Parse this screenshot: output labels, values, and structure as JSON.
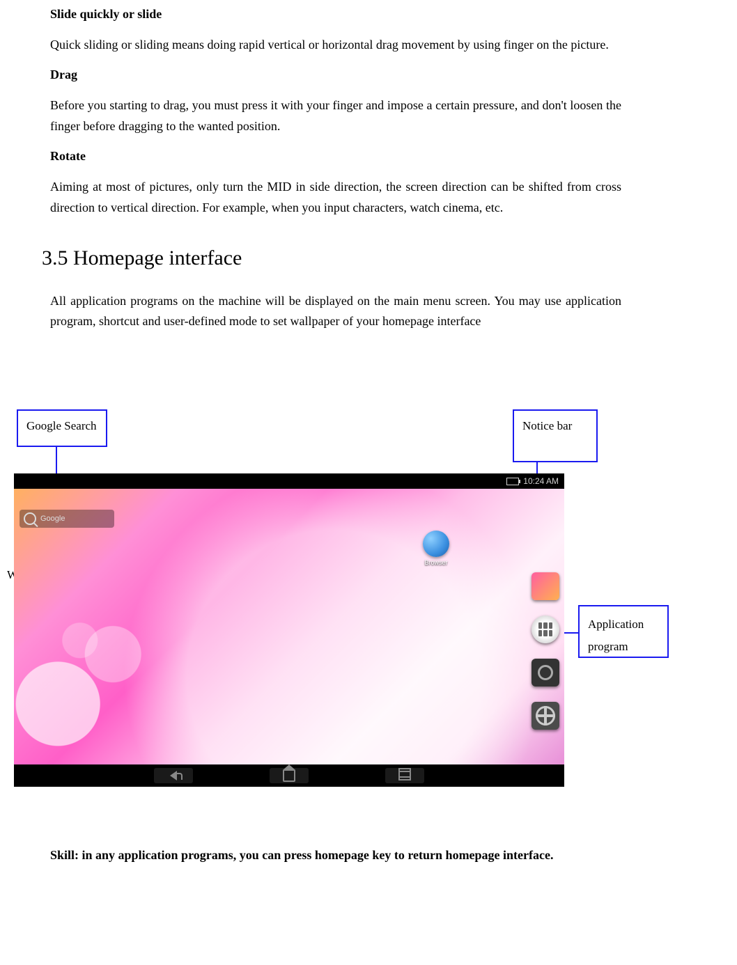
{
  "sections": {
    "slide": {
      "title": "Slide quickly or slide",
      "body": "Quick sliding or sliding means doing rapid vertical or horizontal drag movement by using finger on the picture."
    },
    "drag": {
      "title": "Drag",
      "body": "Before you starting to drag, you must press it with your finger and impose a certain pressure, and don't loosen the finger before dragging to the wanted position."
    },
    "rotate": {
      "title": "Rotate",
      "body": "Aiming at most of pictures, only turn the MID in side direction, the screen direction can be shifted from cross direction to vertical direction. For example, when you input characters, watch cinema, etc."
    },
    "homepage": {
      "heading": "3.5 Homepage interface",
      "intro": "All application programs on the machine will be displayed on the main menu screen. You may use application program, shortcut and user-defined mode to set wallpaper of your homepage interface",
      "skill": "Skill: in any application programs, you can press homepage key to return homepage interface."
    }
  },
  "callouts": {
    "google_search": "Google Search",
    "notice_bar": "Notice bar",
    "wallpaper": "Wallpaper",
    "application_program": "Application program"
  },
  "screenshot": {
    "status_time": "10:24 AM",
    "search_label": "Google",
    "browser_label": "Browser"
  }
}
